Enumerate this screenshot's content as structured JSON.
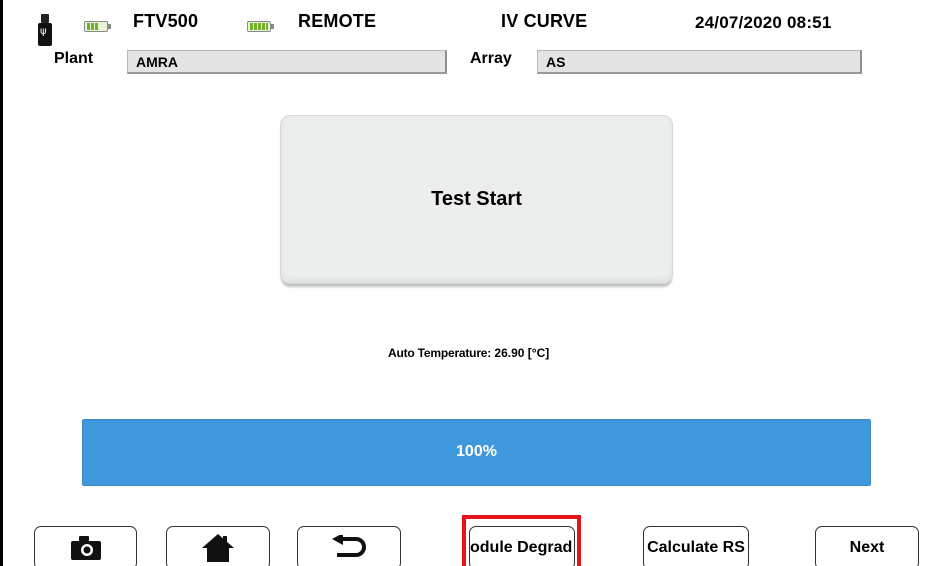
{
  "header": {
    "device": "FTV500",
    "mode": "REMOTE",
    "screen_title": "IV CURVE",
    "datetime": "24/07/2020 08:51",
    "icons": [
      "usb-drive-icon",
      "battery-device-icon",
      "battery-remote-icon"
    ]
  },
  "plant": {
    "label": "Plant",
    "value": "AMRA"
  },
  "array": {
    "label": "Array",
    "value": "AS"
  },
  "test_start_label": "Test Start",
  "temperature": {
    "label": "Auto Temperature:",
    "value": "26.90 [°C]"
  },
  "progress": {
    "value": 1.0,
    "text": "100%"
  },
  "toolbar": {
    "camera_icon": "camera-icon",
    "home_icon": "home-icon",
    "back_icon": "back-arrow-icon",
    "module_degradation": "odule Degrad",
    "calculate_rs": "Calculate RS",
    "next": "Next"
  },
  "colors": {
    "progress_fill": "#3f98dc",
    "highlight": "#e5121c",
    "battery_green": "#6fb12b"
  }
}
